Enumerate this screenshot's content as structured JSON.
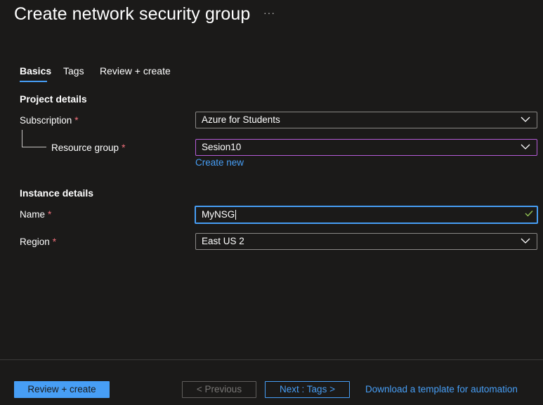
{
  "header": {
    "title": "Create network security group",
    "more_label": "···"
  },
  "tabs": [
    {
      "label": "Basics",
      "active": true
    },
    {
      "label": "Tags",
      "active": false
    },
    {
      "label": "Review + create",
      "active": false
    }
  ],
  "project_details": {
    "heading": "Project details",
    "subscription": {
      "label": "Subscription",
      "required_mark": "*",
      "value": "Azure for Students"
    },
    "resource_group": {
      "label": "Resource group",
      "required_mark": "*",
      "value": "Sesion10",
      "create_new_link": "Create new"
    }
  },
  "instance_details": {
    "heading": "Instance details",
    "name": {
      "label": "Name",
      "required_mark": "*",
      "value": "MyNSG"
    },
    "region": {
      "label": "Region",
      "required_mark": "*",
      "value": "East US 2"
    }
  },
  "footer": {
    "review_create_label": "Review + create",
    "previous_label": "< Previous",
    "next_label": "Next : Tags >",
    "download_template_label": "Download a template for automation"
  },
  "colors": {
    "background": "#1b1a19",
    "accent": "#479ef5",
    "required": "#f1707b",
    "focus_border": "#b65cd8",
    "valid_check": "#92c353"
  },
  "icons": {
    "dropdown": "chevron-down-icon",
    "valid": "checkmark-icon"
  }
}
